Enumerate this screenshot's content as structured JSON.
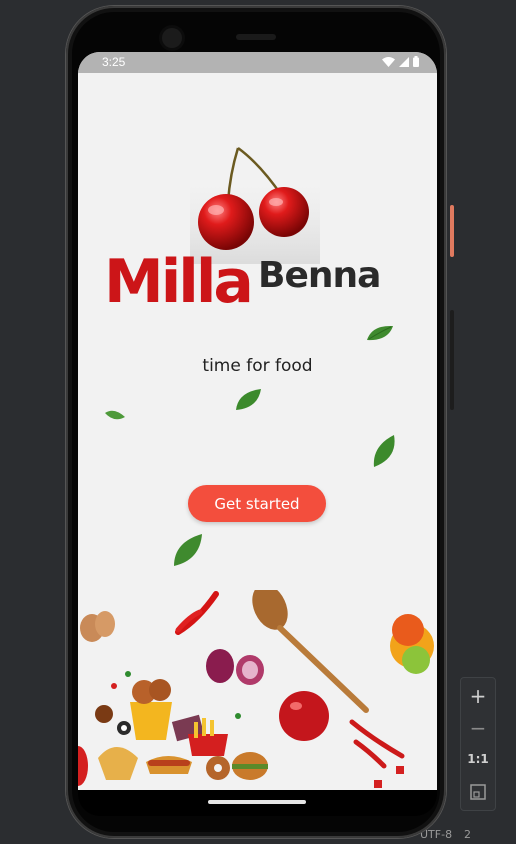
{
  "device": {
    "status_time": "3:25"
  },
  "splash": {
    "brand_primary": "Milla",
    "brand_secondary": "Benna",
    "tagline": "time for food",
    "cta_label": "Get started"
  },
  "emulator_controls": {
    "zoom_in": "+",
    "zoom_out": "−",
    "actual_size": "1:1"
  },
  "colors": {
    "brand_red": "#cc1518",
    "brand_dark": "#2a2a2a",
    "cta": "#f34e3d",
    "screen_bg": "#f2f2f2",
    "status_bar": "#b3b3b3"
  },
  "icons": [
    "wifi-icon",
    "signal-icon",
    "battery-icon",
    "cherry-illustration",
    "leaf-icon",
    "zoom-fit-icon"
  ]
}
